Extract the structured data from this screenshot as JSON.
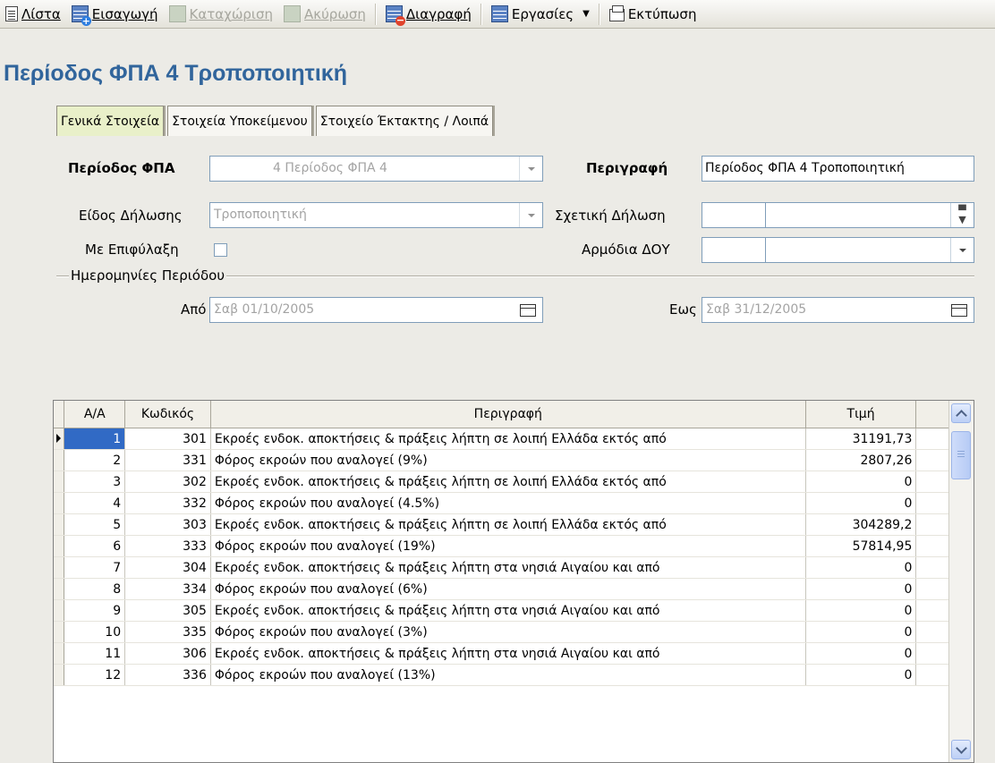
{
  "toolbar": {
    "list": "Λίστα",
    "insert": "Εισαγωγή",
    "save": "Καταχώριση",
    "cancel": "Ακύρωση",
    "delete": "Διαγραφή",
    "tasks": "Εργασίες",
    "print": "Εκτύπωση"
  },
  "page_title": "Περίοδος ΦΠΑ 4 Τροποποιητική",
  "tabs": [
    "Γενικά Στοιχεία",
    "Στοιχεία Υποκείμενου",
    "Στοιχείο Έκτακτης / Λοιπά"
  ],
  "form": {
    "period_label": "Περίοδος ΦΠΑ",
    "period_value": "4  Περίοδος ΦΠΑ 4",
    "description_label": "Περιγραφή",
    "description_value": "Περίοδος ΦΠΑ 4 Τροποποιητική",
    "declaration_type_label": "Είδος Δήλωσης",
    "declaration_type_value": "Τροποποιητική",
    "related_declaration_label": "Σχετική Δήλωση",
    "reservation_label": "Με Επιφύλαξη",
    "tax_office_label": "Αρμόδια ΔΟΥ",
    "dates_group_label": "Ημερομηνίες Περιόδου",
    "from_label": "Από",
    "from_value": "Σαβ 01/10/2005",
    "to_label": "Εως",
    "to_value": "Σαβ 31/12/2005"
  },
  "grid": {
    "columns": [
      "Α/Α",
      "Κωδικός",
      "Περιγραφή",
      "Τιμή"
    ],
    "rows": [
      {
        "aa": "1",
        "code": "301",
        "desc": "Εκροές ενδοκ. αποκτήσεις & πράξεις λήπτη σε λοιπή Ελλάδα εκτός από",
        "value": "31191,73"
      },
      {
        "aa": "2",
        "code": "331",
        "desc": "Φόρος εκροών που αναλογεί (9%)",
        "value": "2807,26"
      },
      {
        "aa": "3",
        "code": "302",
        "desc": "Εκροές ενδοκ. αποκτήσεις & πράξεις λήπτη σε λοιπή Ελλάδα εκτός από",
        "value": "0"
      },
      {
        "aa": "4",
        "code": "332",
        "desc": "Φόρος εκροών που αναλογεί (4.5%)",
        "value": "0"
      },
      {
        "aa": "5",
        "code": "303",
        "desc": "Εκροές ενδοκ. αποκτήσεις & πράξεις λήπτη σε λοιπή Ελλάδα εκτός από",
        "value": "304289,2"
      },
      {
        "aa": "6",
        "code": "333",
        "desc": "Φόρος εκροών που αναλογεί (19%)",
        "value": "57814,95"
      },
      {
        "aa": "7",
        "code": "304",
        "desc": "Εκροές ενδοκ. αποκτήσεις & πράξεις λήπτη στα νησιά Αιγαίου και από",
        "value": "0"
      },
      {
        "aa": "8",
        "code": "334",
        "desc": "Φόρος εκροών που αναλογεί (6%)",
        "value": "0"
      },
      {
        "aa": "9",
        "code": "305",
        "desc": "Εκροές ενδοκ. αποκτήσεις & πράξεις λήπτη στα νησιά Αιγαίου και από",
        "value": "0"
      },
      {
        "aa": "10",
        "code": "335",
        "desc": "Φόρος εκροών που αναλογεί (3%)",
        "value": "0"
      },
      {
        "aa": "11",
        "code": "306",
        "desc": "Εκροές ενδοκ. αποκτήσεις & πράξεις λήπτη στα νησιά Αιγαίου και από",
        "value": "0"
      },
      {
        "aa": "12",
        "code": "336",
        "desc": "Φόρος εκροών που αναλογεί (13%)",
        "value": "0"
      }
    ]
  }
}
